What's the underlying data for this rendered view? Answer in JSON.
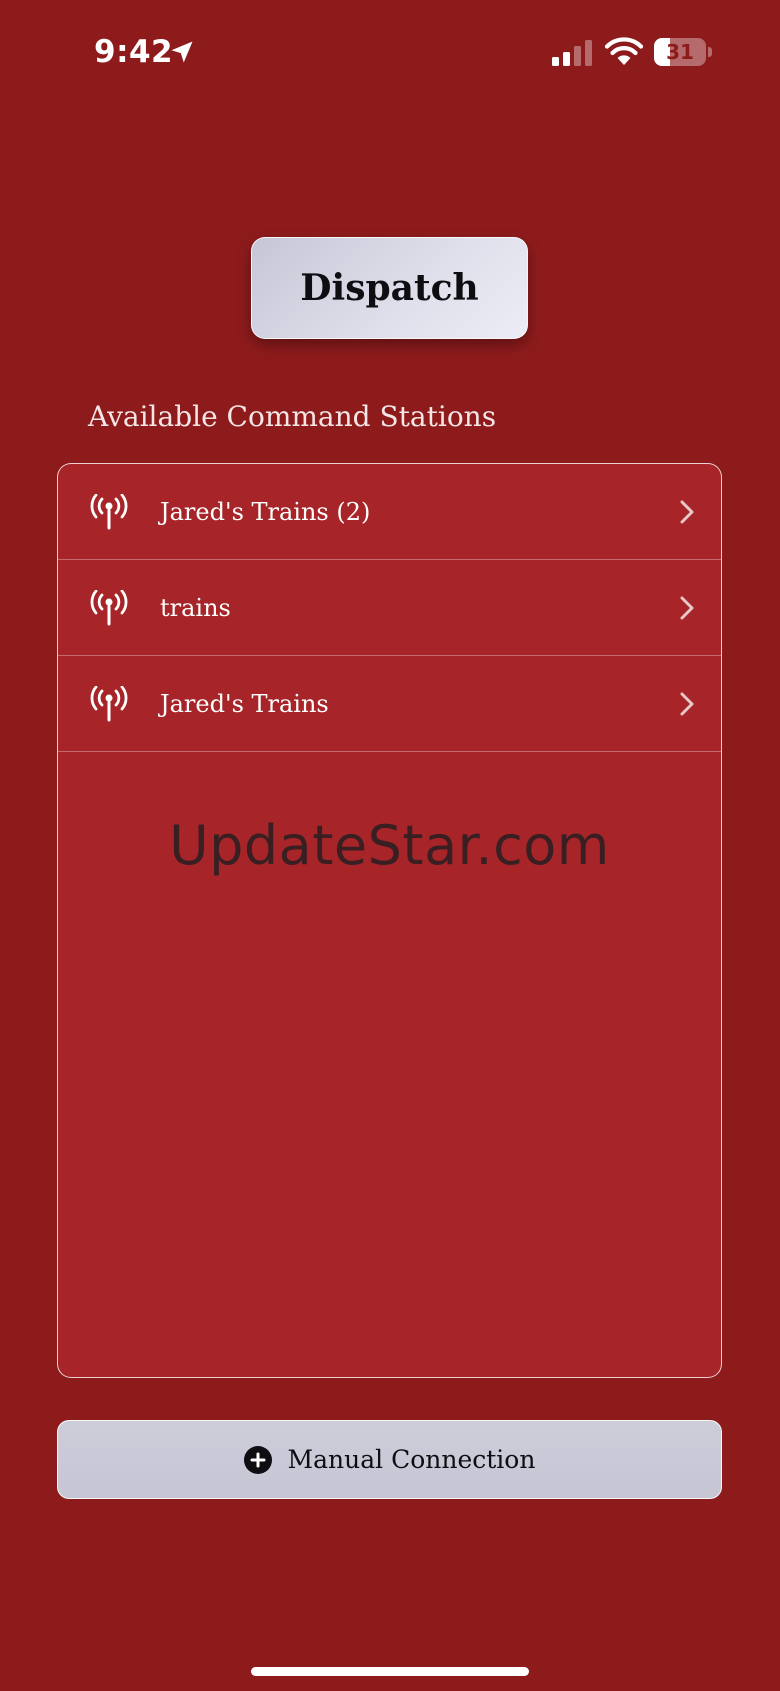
{
  "status_bar": {
    "time": "9:42",
    "battery_level": "31",
    "battery_fraction": 0.31,
    "signal_bars_active": 2,
    "icons": [
      "location-arrow-icon",
      "cellular-signal-icon",
      "wifi-icon",
      "battery-icon"
    ]
  },
  "header": {
    "title": "Dispatch"
  },
  "stations_section": {
    "heading": "Available Command Stations",
    "items": [
      {
        "name": "Jared's Trains (2)",
        "icon": "antenna-icon"
      },
      {
        "name": "trains",
        "icon": "antenna-icon"
      },
      {
        "name": "Jared's Trains",
        "icon": "antenna-icon"
      }
    ],
    "watermark": "UpdateStar.com"
  },
  "manual_connection": {
    "label": "Manual Connection",
    "icon": "plus-circle-icon"
  },
  "colors": {
    "background": "#8e1b1c",
    "panel": "#a72529",
    "button": "#d4d4e2",
    "text_light": "#ffffff",
    "text_dark": "#0e0e12"
  }
}
